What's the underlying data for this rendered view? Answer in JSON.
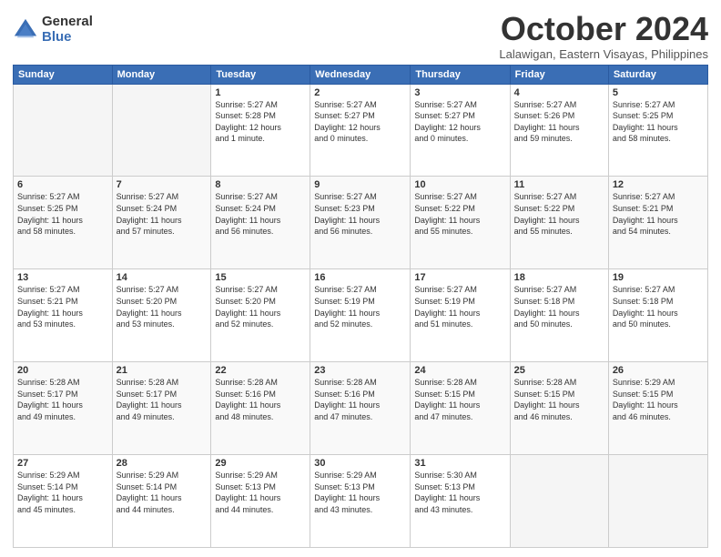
{
  "header": {
    "logo_general": "General",
    "logo_blue": "Blue",
    "month_title": "October 2024",
    "location": "Lalawigan, Eastern Visayas, Philippines"
  },
  "columns": [
    "Sunday",
    "Monday",
    "Tuesday",
    "Wednesday",
    "Thursday",
    "Friday",
    "Saturday"
  ],
  "weeks": [
    [
      {
        "day": "",
        "info": ""
      },
      {
        "day": "",
        "info": ""
      },
      {
        "day": "1",
        "info": "Sunrise: 5:27 AM\nSunset: 5:28 PM\nDaylight: 12 hours\nand 1 minute."
      },
      {
        "day": "2",
        "info": "Sunrise: 5:27 AM\nSunset: 5:27 PM\nDaylight: 12 hours\nand 0 minutes."
      },
      {
        "day": "3",
        "info": "Sunrise: 5:27 AM\nSunset: 5:27 PM\nDaylight: 12 hours\nand 0 minutes."
      },
      {
        "day": "4",
        "info": "Sunrise: 5:27 AM\nSunset: 5:26 PM\nDaylight: 11 hours\nand 59 minutes."
      },
      {
        "day": "5",
        "info": "Sunrise: 5:27 AM\nSunset: 5:25 PM\nDaylight: 11 hours\nand 58 minutes."
      }
    ],
    [
      {
        "day": "6",
        "info": "Sunrise: 5:27 AM\nSunset: 5:25 PM\nDaylight: 11 hours\nand 58 minutes."
      },
      {
        "day": "7",
        "info": "Sunrise: 5:27 AM\nSunset: 5:24 PM\nDaylight: 11 hours\nand 57 minutes."
      },
      {
        "day": "8",
        "info": "Sunrise: 5:27 AM\nSunset: 5:24 PM\nDaylight: 11 hours\nand 56 minutes."
      },
      {
        "day": "9",
        "info": "Sunrise: 5:27 AM\nSunset: 5:23 PM\nDaylight: 11 hours\nand 56 minutes."
      },
      {
        "day": "10",
        "info": "Sunrise: 5:27 AM\nSunset: 5:22 PM\nDaylight: 11 hours\nand 55 minutes."
      },
      {
        "day": "11",
        "info": "Sunrise: 5:27 AM\nSunset: 5:22 PM\nDaylight: 11 hours\nand 55 minutes."
      },
      {
        "day": "12",
        "info": "Sunrise: 5:27 AM\nSunset: 5:21 PM\nDaylight: 11 hours\nand 54 minutes."
      }
    ],
    [
      {
        "day": "13",
        "info": "Sunrise: 5:27 AM\nSunset: 5:21 PM\nDaylight: 11 hours\nand 53 minutes."
      },
      {
        "day": "14",
        "info": "Sunrise: 5:27 AM\nSunset: 5:20 PM\nDaylight: 11 hours\nand 53 minutes."
      },
      {
        "day": "15",
        "info": "Sunrise: 5:27 AM\nSunset: 5:20 PM\nDaylight: 11 hours\nand 52 minutes."
      },
      {
        "day": "16",
        "info": "Sunrise: 5:27 AM\nSunset: 5:19 PM\nDaylight: 11 hours\nand 52 minutes."
      },
      {
        "day": "17",
        "info": "Sunrise: 5:27 AM\nSunset: 5:19 PM\nDaylight: 11 hours\nand 51 minutes."
      },
      {
        "day": "18",
        "info": "Sunrise: 5:27 AM\nSunset: 5:18 PM\nDaylight: 11 hours\nand 50 minutes."
      },
      {
        "day": "19",
        "info": "Sunrise: 5:27 AM\nSunset: 5:18 PM\nDaylight: 11 hours\nand 50 minutes."
      }
    ],
    [
      {
        "day": "20",
        "info": "Sunrise: 5:28 AM\nSunset: 5:17 PM\nDaylight: 11 hours\nand 49 minutes."
      },
      {
        "day": "21",
        "info": "Sunrise: 5:28 AM\nSunset: 5:17 PM\nDaylight: 11 hours\nand 49 minutes."
      },
      {
        "day": "22",
        "info": "Sunrise: 5:28 AM\nSunset: 5:16 PM\nDaylight: 11 hours\nand 48 minutes."
      },
      {
        "day": "23",
        "info": "Sunrise: 5:28 AM\nSunset: 5:16 PM\nDaylight: 11 hours\nand 47 minutes."
      },
      {
        "day": "24",
        "info": "Sunrise: 5:28 AM\nSunset: 5:15 PM\nDaylight: 11 hours\nand 47 minutes."
      },
      {
        "day": "25",
        "info": "Sunrise: 5:28 AM\nSunset: 5:15 PM\nDaylight: 11 hours\nand 46 minutes."
      },
      {
        "day": "26",
        "info": "Sunrise: 5:29 AM\nSunset: 5:15 PM\nDaylight: 11 hours\nand 46 minutes."
      }
    ],
    [
      {
        "day": "27",
        "info": "Sunrise: 5:29 AM\nSunset: 5:14 PM\nDaylight: 11 hours\nand 45 minutes."
      },
      {
        "day": "28",
        "info": "Sunrise: 5:29 AM\nSunset: 5:14 PM\nDaylight: 11 hours\nand 44 minutes."
      },
      {
        "day": "29",
        "info": "Sunrise: 5:29 AM\nSunset: 5:13 PM\nDaylight: 11 hours\nand 44 minutes."
      },
      {
        "day": "30",
        "info": "Sunrise: 5:29 AM\nSunset: 5:13 PM\nDaylight: 11 hours\nand 43 minutes."
      },
      {
        "day": "31",
        "info": "Sunrise: 5:30 AM\nSunset: 5:13 PM\nDaylight: 11 hours\nand 43 minutes."
      },
      {
        "day": "",
        "info": ""
      },
      {
        "day": "",
        "info": ""
      }
    ]
  ]
}
